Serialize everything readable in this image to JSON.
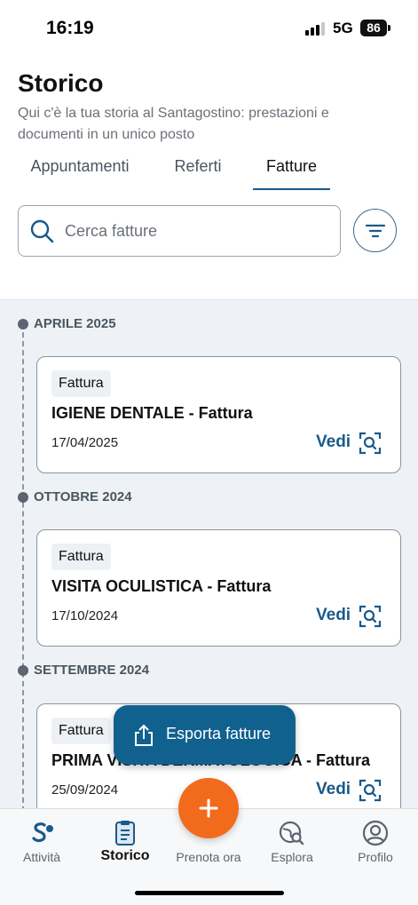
{
  "status_bar": {
    "time": "16:19",
    "network": "5G",
    "battery": "86"
  },
  "header": {
    "title": "Storico",
    "subtitle": "Qui c'è la tua storia al Santagostino: prestazioni e documenti in un unico posto"
  },
  "tabs": [
    {
      "label": "Appuntamenti",
      "active": false
    },
    {
      "label": "Referti",
      "active": false
    },
    {
      "label": "Fatture",
      "active": true
    }
  ],
  "search": {
    "placeholder": "Cerca fatture",
    "value": ""
  },
  "timeline": [
    {
      "month": "APRILE 2025",
      "card": {
        "badge": "Fattura",
        "title": "IGIENE DENTALE - Fattura",
        "date": "17/04/2025",
        "action": "Vedi"
      }
    },
    {
      "month": "OTTOBRE 2024",
      "card": {
        "badge": "Fattura",
        "title": "VISITA OCULISTICA - Fattura",
        "date": "17/10/2024",
        "action": "Vedi"
      }
    },
    {
      "month": "SETTEMBRE 2024",
      "card": {
        "badge": "Fattura",
        "title": "PRIMA VISITA DERMATOLOGICA - Fattura",
        "date": "25/09/2024",
        "action": "Vedi"
      }
    }
  ],
  "export_button": {
    "label": "Esporta fatture"
  },
  "bottom_nav": [
    {
      "label": "Attività",
      "icon": "santagostino-logo-icon",
      "active": false
    },
    {
      "label": "Storico",
      "icon": "document-list-icon",
      "active": true
    },
    {
      "label": "Prenota ora",
      "icon": "plus-icon",
      "active": false
    },
    {
      "label": "Esplora",
      "icon": "globe-search-icon",
      "active": false
    },
    {
      "label": "Profilo",
      "icon": "user-circle-icon",
      "active": false
    }
  ],
  "colors": {
    "accent": "#11618f",
    "fab": "#f26b1d",
    "background_timeline": "#eef2f6"
  }
}
